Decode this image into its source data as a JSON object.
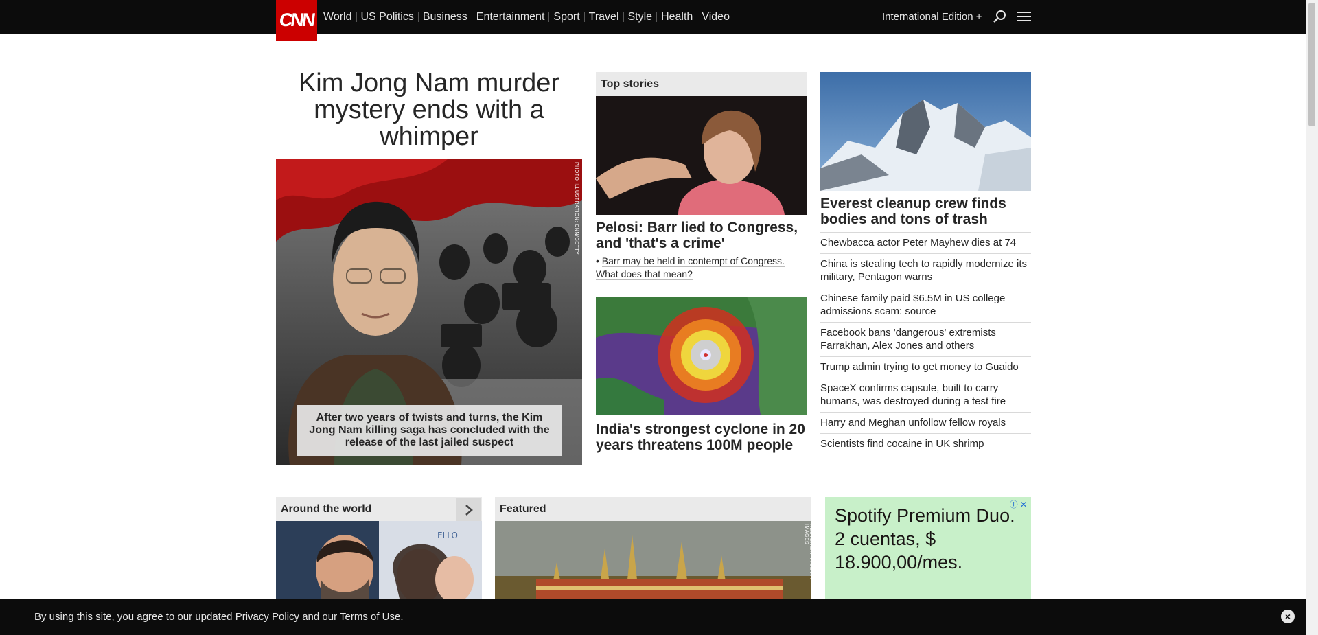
{
  "header": {
    "logo": "CNN",
    "nav": [
      "World",
      "US Politics",
      "Business",
      "Entertainment",
      "Sport",
      "Travel",
      "Style",
      "Health",
      "Video"
    ],
    "edition": "International Edition +",
    "search_icon": "search-icon",
    "menu_icon": "menu-icon"
  },
  "hero": {
    "title": "Kim Jong Nam murder mystery ends with a whimper",
    "caption": "After two years of twists and turns, the Kim Jong Nam killing saga has concluded with the release of the last jailed suspect",
    "credit": "PHOTO ILLUSTRATION: CNN/GETTY"
  },
  "top_stories": {
    "heading": "Top stories",
    "story1": {
      "title": "Pelosi: Barr lied to Congress, and 'that's a crime'",
      "sub": "Barr may be held in contempt of Congress. What does that mean?"
    },
    "story2": {
      "title": "India's strongest cyclone in 20 years threatens 100M people"
    }
  },
  "right_column": {
    "lead_title": "Everest cleanup crew finds bodies and tons of trash",
    "headlines": [
      "Chewbacca actor Peter Mayhew dies at 74",
      "China is stealing tech to rapidly modernize its military, Pentagon warns",
      "Chinese family paid $6.5M in US college admissions scam: source",
      "Facebook bans 'dangerous' extremists Farrakhan, Alex Jones and others",
      "Trump admin trying to get money to Guaido",
      "SpaceX confirms capsule, built to carry humans, was destroyed during a test fire",
      "Harry and Meghan unfollow fellow royals",
      "Scientists find cocaine in UK shrimp"
    ]
  },
  "lower": {
    "around_heading": "Around the world",
    "featured_heading": "Featured",
    "featured_credit": "REUTERS/AFP/GETTY IMAGES",
    "ad_text": "Spotify Premium Duo. 2 cuentas, $ 18.900,00/mes."
  },
  "cookie_bar": {
    "prefix": "By using this site, you agree to our updated ",
    "privacy": "Privacy Policy",
    "middle": " and our ",
    "terms": "Terms of Use",
    "suffix": "."
  },
  "colors": {
    "brand_red": "#cc0000",
    "nav_bg": "#0c0c0c",
    "ad_bg": "#c8f0c9"
  }
}
